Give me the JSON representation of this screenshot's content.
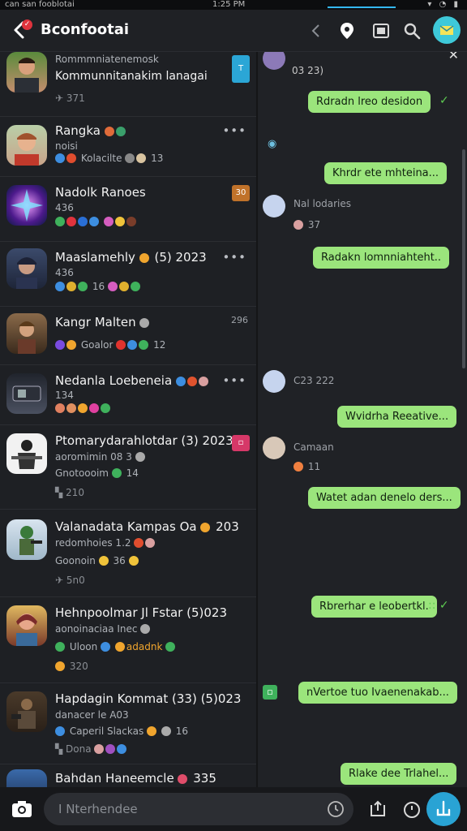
{
  "status_bar": {
    "carrier": "ca‍n san fooblotai",
    "time": "1:25 PM",
    "progress_pct": 100
  },
  "header": {
    "title": "Bconfootai",
    "badge": "✓"
  },
  "chats": [
    {
      "name": "Rommmniatenemosk",
      "sub": "Kommunnitanakim lanagai",
      "line3": "",
      "line4": "371",
      "tag": "T"
    },
    {
      "name": "Rangka",
      "sub": "noisi",
      "line3": "Kolacilte",
      "line3_count": "13",
      "line4": ""
    },
    {
      "name": "Nadolk Ranoes",
      "sub": "436",
      "line3": "",
      "line4": "",
      "tag": "30"
    },
    {
      "name": "Maaslamehly",
      "name_suffix": "(5) 2023",
      "sub": "436",
      "line3": "16",
      "line4": ""
    },
    {
      "name": "Kangr Malten",
      "sub": "",
      "line3": "Goalor",
      "line3_count": "12",
      "line4": "",
      "time": "296"
    },
    {
      "name": "Nedanla Loebeneia",
      "sub": "134",
      "line3": "",
      "line4": ""
    },
    {
      "name": "Ptomarydarahlotdar",
      "name_suffix": "(3) 2023",
      "sub": "aoromimin 08 3",
      "line3": "Gnotoooim",
      "line3_count": "14",
      "line4": "210"
    },
    {
      "name": "Valanadata Kampas Oa",
      "name_suffix": "203",
      "sub": "redomhoies 1.2",
      "line3": "Goonoin",
      "line3_count": "36",
      "line4": "5n0"
    },
    {
      "name": "Hehnpoolmar Jl Fstar",
      "name_suffix": "(5)023",
      "sub": "aonoinaciaa Inec",
      "line3": "Uloon",
      "line3_extra": "adadnk",
      "line4": "320"
    },
    {
      "name": "Hapdagin Kommat (33)",
      "name_suffix": "(5)023",
      "sub": "danacer le A03",
      "line3": "Caperil Slackas",
      "line3_count": "16",
      "line4": "Dona"
    },
    {
      "name": "Bahdan Haneemcle",
      "name_suffix": "335"
    }
  ],
  "conversation": {
    "top_meta": "03 23)",
    "messages": [
      {
        "kind": "out",
        "text": "Rdradn lreo desidon"
      },
      {
        "kind": "out",
        "text": "Khrdr ete mhteina..."
      },
      {
        "kind": "in",
        "name": "Nal lodaries",
        "meta": "37"
      },
      {
        "kind": "out",
        "text": "Radakn lomnniahteht.."
      },
      {
        "kind": "in",
        "name": "C23 222",
        "meta": ""
      },
      {
        "kind": "out",
        "text": "Wvidrha Reeative..."
      },
      {
        "kind": "in",
        "name": "Camaan",
        "meta": "11"
      },
      {
        "kind": "out",
        "text": "Watet adan denelo ders..."
      },
      {
        "kind": "out",
        "text": "Rbrerhar e leobertkl."
      },
      {
        "kind": "out",
        "text": "nVertoe tuo Ivaenenakab..."
      },
      {
        "kind": "out",
        "text": "Rlake dee Trlahel..."
      }
    ]
  },
  "composer": {
    "placeholder": "I Nterhendee"
  },
  "colors": {
    "accent": "#29a3d4",
    "bubble": "#9be57c",
    "tick": "#5ecc52"
  }
}
